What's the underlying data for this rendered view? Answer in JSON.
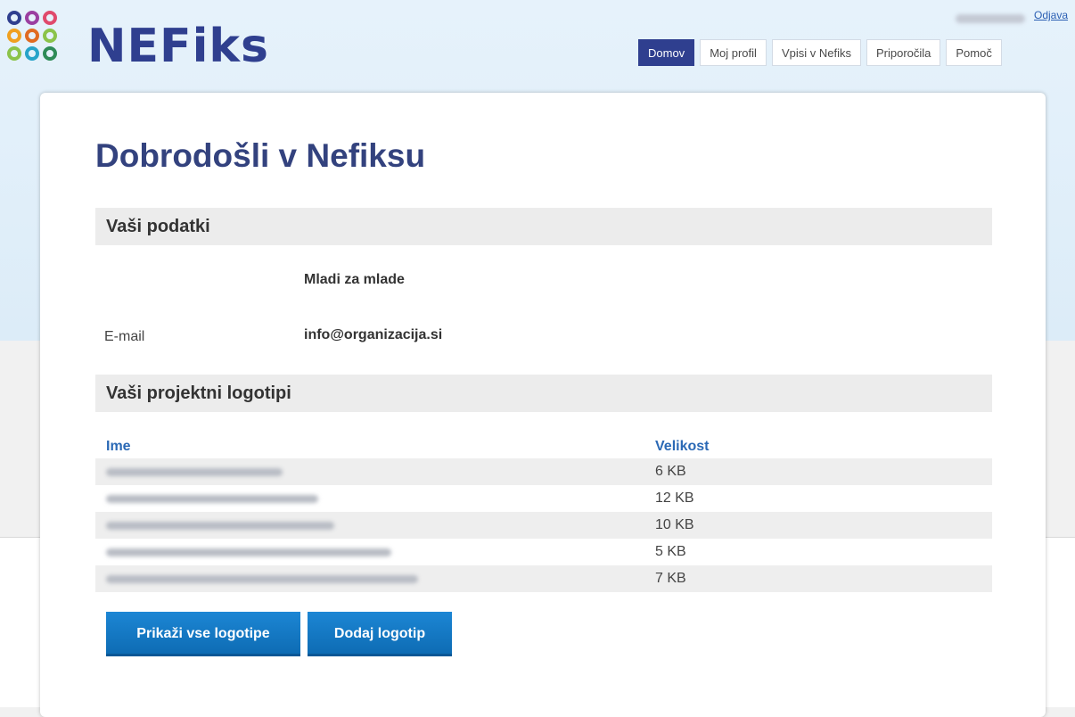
{
  "logo": {
    "text": "NEFiks"
  },
  "header": {
    "logout_label": "Odjava"
  },
  "nav": {
    "tabs": [
      {
        "label": "Domov",
        "active": true
      },
      {
        "label": "Moj profil"
      },
      {
        "label": "Vpisi v Nefiks"
      },
      {
        "label": "Priporočila"
      },
      {
        "label": "Pomoč"
      }
    ]
  },
  "main": {
    "title": "Dobrodošli v Nefiksu",
    "data_section": {
      "title": "Vaši podatki",
      "org_name": "Mladi za mlade",
      "email_label": "E-mail",
      "email_value": "info@organizacija.si"
    },
    "logos_section": {
      "title": "Vaši projektni logotipi",
      "col_name": "Ime",
      "col_size": "Velikost",
      "rows": [
        {
          "size": "6 KB"
        },
        {
          "size": "12 KB"
        },
        {
          "size": "10 KB"
        },
        {
          "size": "5 KB"
        },
        {
          "size": "7 KB"
        }
      ]
    },
    "buttons": {
      "show_all": "Prikaži vse logotipe",
      "add": "Dodaj logotip"
    }
  },
  "colors": {
    "brand": "#2f3f8f",
    "nav_active": "#2f3f8f",
    "button": "#1479c4",
    "link": "#2b69b5"
  }
}
